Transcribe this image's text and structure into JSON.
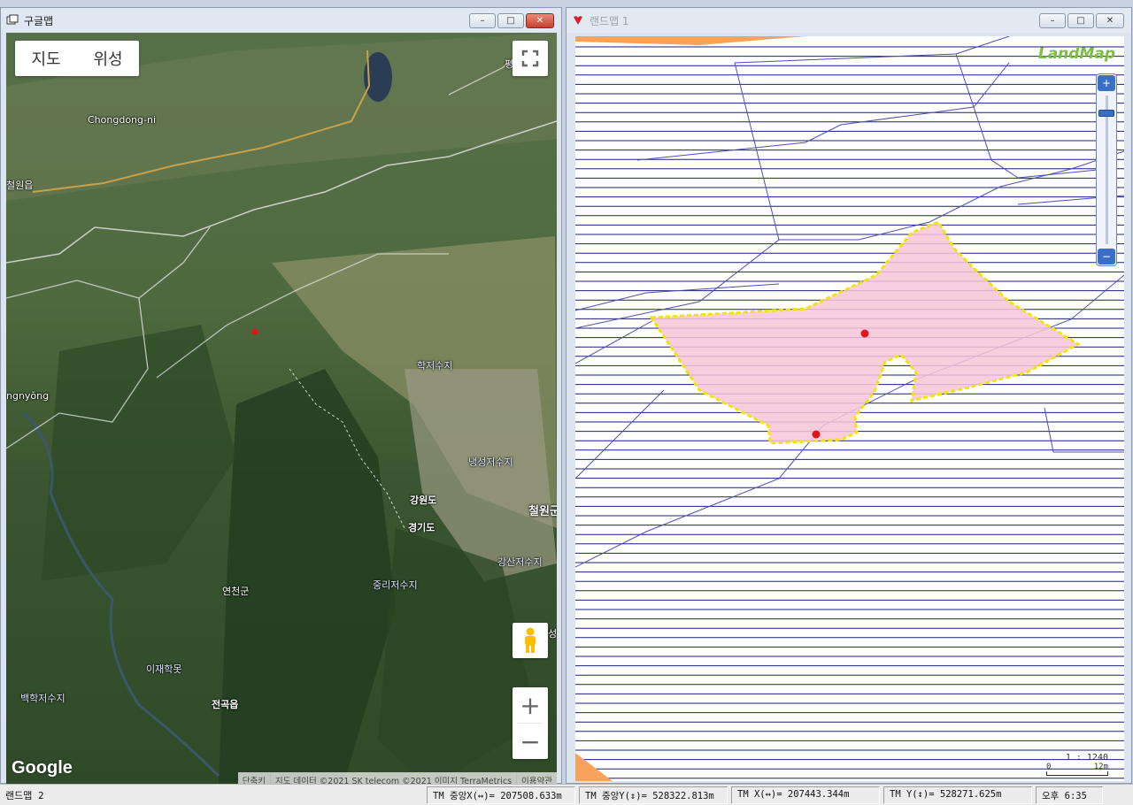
{
  "left_window": {
    "title": "구글맵",
    "map_type": {
      "map": "지도",
      "satellite": "위성"
    },
    "places": {
      "chongdong": "Chongdong-ni",
      "cheorwon_eup": "철원읍",
      "pyeong": "평",
      "ngnyong": "ngnyŏng",
      "hakjeo": "학저수지",
      "naengseong": "냉성저수지",
      "gangwon": "강원도",
      "cheorwon_gun": "철원군",
      "gyeonggi": "경기도",
      "gangsan": "강산저수지",
      "jungri": "중리저수지",
      "yeoncheon": "연천군",
      "ijae": "이재학못",
      "baekhak": "백학저수지",
      "jeongok": "전곡읍",
      "seong": "성"
    },
    "google_logo": "Google",
    "attribution": [
      "단축키",
      "지도 데이터 ©2021 SK telecom ©2021 이미지 TerraMetrics",
      "이용약관"
    ],
    "zoom_in": "+",
    "zoom_out": "−"
  },
  "right_window": {
    "title": "랜드맵 1",
    "logo": "LandMap",
    "scale_ratio": "1 : 1240",
    "scale_zero": "0",
    "scale_len": "12m",
    "parcel_fill": "#f7c6d9",
    "parcel_border": "#f2e600"
  },
  "statusbar": {
    "app": "랜드맵 2",
    "tm_center_x": "TM 중앙X(↔)= 207508.633m",
    "tm_center_y": "TM 중앙Y(↕)= 528322.813m",
    "tm_x": "TM X(↔)= 207443.344m",
    "tm_y": "TM Y(↕)= 528271.625m",
    "time": "오후 6:35"
  },
  "window_buttons": {
    "minimize": "–",
    "maximize": "□",
    "close": "✕"
  }
}
